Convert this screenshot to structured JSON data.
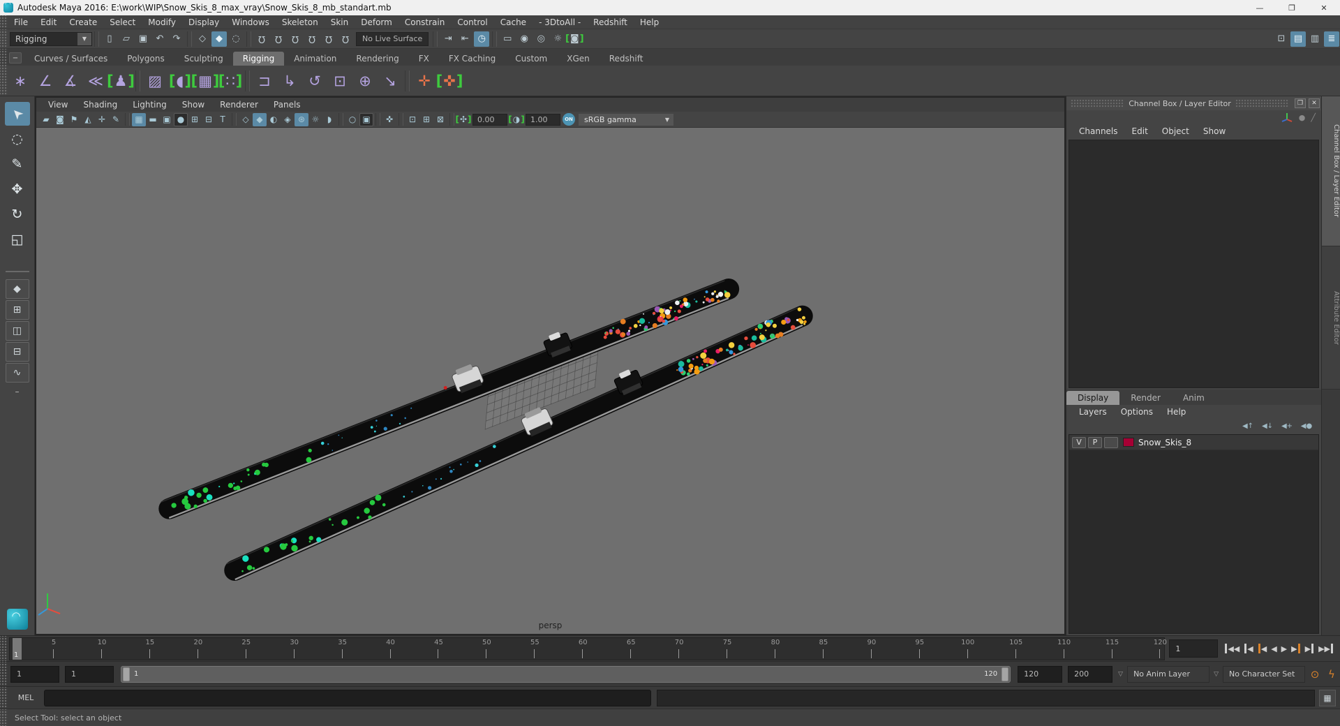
{
  "window": {
    "title": "Autodesk Maya 2016: E:\\work\\WIP\\Snow_Skis_8_max_vray\\Snow_Skis_8_mb_standart.mb",
    "minimize": "—",
    "restore": "❐",
    "close": "✕"
  },
  "menu_bar": {
    "items": [
      "File",
      "Edit",
      "Create",
      "Select",
      "Modify",
      "Display",
      "Windows",
      "Skeleton",
      "Skin",
      "Deform",
      "Constrain",
      "Control",
      "Cache",
      "- 3DtoAll -",
      "Redshift",
      "Help"
    ]
  },
  "status_line": {
    "menu_set": "Rigging",
    "items": [
      {
        "sep": true
      },
      {
        "name": "new-scene",
        "g": "▯"
      },
      {
        "name": "open-scene",
        "g": "▱"
      },
      {
        "name": "save-scene",
        "g": "▣"
      },
      {
        "name": "undo",
        "g": "↶"
      },
      {
        "name": "redo",
        "g": "↷"
      },
      {
        "sep": true
      },
      {
        "name": "select-by-hierarchy",
        "g": "◇"
      },
      {
        "name": "select-by-object",
        "g": "◆",
        "active": true
      },
      {
        "name": "select-by-component",
        "g": "◌"
      },
      {
        "sep": true
      },
      {
        "name": "snap-to-grid",
        "g": "Ω",
        "cls": "flip"
      },
      {
        "name": "snap-to-curve",
        "g": "Ω",
        "cls": "flip"
      },
      {
        "name": "snap-to-point",
        "g": "Ω",
        "cls": "flip"
      },
      {
        "name": "snap-to-projected-center",
        "g": "Ω",
        "cls": "flip"
      },
      {
        "name": "snap-to-view-plane",
        "g": "Ω",
        "cls": "flip"
      },
      {
        "name": "make-live",
        "g": "Ω",
        "cls": "flip"
      },
      {
        "field": "No Live Surface",
        "name": "live-surface-field"
      },
      {
        "sep": true
      },
      {
        "name": "input-connections",
        "g": "⇥"
      },
      {
        "name": "output-connections",
        "g": "⇤"
      },
      {
        "name": "construction-history",
        "g": "◷",
        "active": true
      },
      {
        "sep": true
      },
      {
        "name": "open-render-view",
        "g": "▭"
      },
      {
        "name": "render-current-frame",
        "g": "◉"
      },
      {
        "name": "ipr-render",
        "g": "◎"
      },
      {
        "name": "render-settings",
        "g": "☼"
      },
      {
        "name": "redshift-render-view",
        "g": "◙",
        "brk": true
      }
    ],
    "right_items": [
      {
        "name": "toggle-modeling-toolkit",
        "g": "⊡"
      },
      {
        "name": "toggle-channel-box",
        "g": "▤",
        "active": true
      },
      {
        "name": "toggle-attribute-editor",
        "g": "▥"
      },
      {
        "name": "toggle-display-layers",
        "g": "≣",
        "active": true
      }
    ]
  },
  "shelf": {
    "menu_btn": "−",
    "tabs": [
      "Curves / Surfaces",
      "Polygons",
      "Sculpting",
      "Rigging",
      "Animation",
      "Rendering",
      "FX",
      "FX Caching",
      "Custom",
      "XGen",
      "Redshift"
    ],
    "active_tab": "Rigging",
    "items": [
      {
        "name": "joint-tool",
        "g": "∗"
      },
      {
        "name": "ik-handle-tool",
        "g": "∠"
      },
      {
        "name": "insert-joint-tool",
        "g": "∡"
      },
      {
        "name": "mirror-joint",
        "g": "≪"
      },
      {
        "name": "quick-rig",
        "g": "♟",
        "brk": true
      },
      {
        "sep": true
      },
      {
        "name": "paint-skin-weights",
        "g": "▨"
      },
      {
        "name": "bind-skin",
        "g": "◖",
        "brk": true
      },
      {
        "name": "lattice-deformer",
        "g": "▦",
        "brk": true
      },
      {
        "name": "cluster-deformer",
        "g": "∷",
        "brk": true
      },
      {
        "sep": true
      },
      {
        "name": "parent-constraint",
        "g": "⊐"
      },
      {
        "name": "point-constraint",
        "g": "↳"
      },
      {
        "name": "orient-constraint",
        "g": "↺"
      },
      {
        "name": "scale-constraint",
        "g": "⊡"
      },
      {
        "name": "aim-constraint",
        "g": "⊕"
      },
      {
        "name": "pole-vector-constraint",
        "g": "↘"
      },
      {
        "sep": true
      },
      {
        "name": "set-driven-key",
        "g": "✛",
        "orange": true
      },
      {
        "name": "hik-control",
        "g": "✜",
        "orange": true,
        "brk": true
      }
    ]
  },
  "toolbox": {
    "tools": [
      {
        "name": "select-tool",
        "g": "➤",
        "cls": "rot-up",
        "active": true
      },
      {
        "name": "lasso-select-tool",
        "g": "◌"
      },
      {
        "name": "paint-select-tool",
        "g": "✎"
      },
      {
        "name": "move-tool",
        "g": "✥"
      },
      {
        "name": "rotate-tool",
        "g": "↻"
      },
      {
        "name": "scale-tool",
        "g": "◱"
      }
    ],
    "layouts": [
      {
        "name": "layout-single-pane",
        "g": "◆"
      },
      {
        "name": "layout-four-panes",
        "g": "⊞"
      },
      {
        "name": "layout-two-panes-side",
        "g": "◫"
      },
      {
        "name": "layout-persp-outliner",
        "g": "⊟"
      },
      {
        "name": "layout-persp-graph",
        "g": "∿"
      }
    ],
    "more_layouts": "–"
  },
  "viewport": {
    "menus": [
      "View",
      "Shading",
      "Lighting",
      "Show",
      "Renderer",
      "Panels"
    ],
    "toolbar": [
      {
        "name": "select-camera",
        "g": "▰"
      },
      {
        "name": "camera-attributes",
        "g": "◙"
      },
      {
        "name": "bookmarks",
        "g": "⚑"
      },
      {
        "name": "image-plane",
        "g": "◭"
      },
      {
        "name": "2d-pan-zoom",
        "g": "✛"
      },
      {
        "name": "grease-pencil",
        "g": "✎"
      },
      {
        "sep": true
      },
      {
        "name": "show-grid",
        "g": "▦",
        "active": true
      },
      {
        "name": "film-gate",
        "g": "▬"
      },
      {
        "name": "resolution-gate",
        "g": "▣"
      },
      {
        "name": "gate-mask",
        "g": "●",
        "pressed": true
      },
      {
        "name": "field-chart",
        "g": "⊞"
      },
      {
        "name": "safe-action",
        "g": "⊟"
      },
      {
        "name": "safe-title",
        "g": "T"
      },
      {
        "sep": true
      },
      {
        "name": "wireframe-display",
        "g": "◇"
      },
      {
        "name": "smooth-shade-display",
        "g": "◆",
        "active": true
      },
      {
        "name": "use-default-material",
        "g": "◐"
      },
      {
        "name": "textured-display",
        "g": "◈"
      },
      {
        "name": "use-all-lights",
        "g": "⊛",
        "active": true
      },
      {
        "name": "shadows",
        "g": "☼"
      },
      {
        "name": "screen-space-ao",
        "g": "◗"
      },
      {
        "sep": true
      },
      {
        "name": "motion-blur",
        "g": "○"
      },
      {
        "name": "multisample-aa",
        "g": "▣",
        "pressed": true
      },
      {
        "sep": true
      },
      {
        "name": "isolate-select",
        "g": "✜"
      },
      {
        "sep": true
      },
      {
        "name": "isolate-view-selected",
        "g": "⊡"
      },
      {
        "name": "isolate-add-selected",
        "g": "⊞"
      },
      {
        "name": "isolate-remove-selected",
        "g": "⊠"
      },
      {
        "sep": true
      },
      {
        "name": "exposure-toggle",
        "g": "✣",
        "brk": true
      },
      {
        "field": "0.00",
        "name": "exposure-field"
      },
      {
        "name": "contrast-toggle",
        "g": "◑",
        "brk": true
      },
      {
        "field": "1.00",
        "name": "contrast-field"
      },
      {
        "name": "gamma-toggle",
        "g": "ON",
        "round": true
      },
      {
        "dropdown": "sRGB gamma",
        "name": "view-transform-dropdown"
      }
    ],
    "camera_label": "persp"
  },
  "channel_box": {
    "title": "Channel Box / Layer Editor",
    "float_btn": "❒",
    "close_btn": "✕",
    "menus": [
      "Channels",
      "Edit",
      "Object",
      "Show"
    ]
  },
  "layer_editor": {
    "tabs": [
      "Display",
      "Render",
      "Anim"
    ],
    "active_tab": "Display",
    "menus": [
      "Layers",
      "Options",
      "Help"
    ],
    "icons": [
      {
        "name": "move-layer-up",
        "g": "◀↑"
      },
      {
        "name": "move-layer-down",
        "g": "◀↓"
      },
      {
        "name": "create-empty-layer",
        "g": "◀+"
      },
      {
        "name": "create-layer-from-selected",
        "g": "◀●"
      }
    ],
    "layers": [
      {
        "v": "V",
        "p": "P",
        "name": "Snow_Skis_8",
        "color": "#a50034"
      }
    ]
  },
  "side_tabs": [
    {
      "label": "Channel Box / Layer Editor",
      "active": true
    },
    {
      "label": "Attribute Editor",
      "active": false
    }
  ],
  "time_slider": {
    "tick_labels": [
      5,
      10,
      15,
      20,
      25,
      30,
      35,
      40,
      45,
      50,
      55,
      60,
      65,
      70,
      75,
      80,
      85,
      90,
      95,
      100,
      105,
      110,
      115,
      120
    ],
    "current_frame": "1",
    "current_time": "1",
    "transport": [
      {
        "name": "go-to-start",
        "bar": "left",
        "g": "◀◀"
      },
      {
        "name": "step-back-frame",
        "bar": "left",
        "g": "◀"
      },
      {
        "name": "step-back-key",
        "bar": "left",
        "g": "◀",
        "key": true
      },
      {
        "name": "play-backwards",
        "g": "◀"
      },
      {
        "name": "play-forwards",
        "g": "▶"
      },
      {
        "name": "step-forward-key",
        "bar": "right",
        "g": "▶",
        "key": true
      },
      {
        "name": "step-forward-frame",
        "bar": "right",
        "g": "▶"
      },
      {
        "name": "go-to-end",
        "bar": "right",
        "g": "▶▶"
      }
    ]
  },
  "range_slider": {
    "anim_start": "1",
    "playback_start": "1",
    "bar_start_label": "1",
    "bar_end_label": "120",
    "playback_end": "120",
    "anim_end": "200",
    "anim_layer": "No Anim Layer",
    "character_set": "No Character Set",
    "auto_key_icon": "⊙",
    "anim_prefs_icon": "ϟ"
  },
  "command_line": {
    "label": "MEL",
    "script_editor_icon": "▦"
  },
  "help_line": {
    "text": "Select Tool: select an object"
  },
  "colors": {
    "accent_blue": "#5b8aa6",
    "shelf_purple": "#b4a3e0",
    "bracket_green": "#3ecb3e",
    "orange": "#d9822b",
    "layer_red": "#a50034",
    "viewport_bg": "#6f6f6f"
  }
}
